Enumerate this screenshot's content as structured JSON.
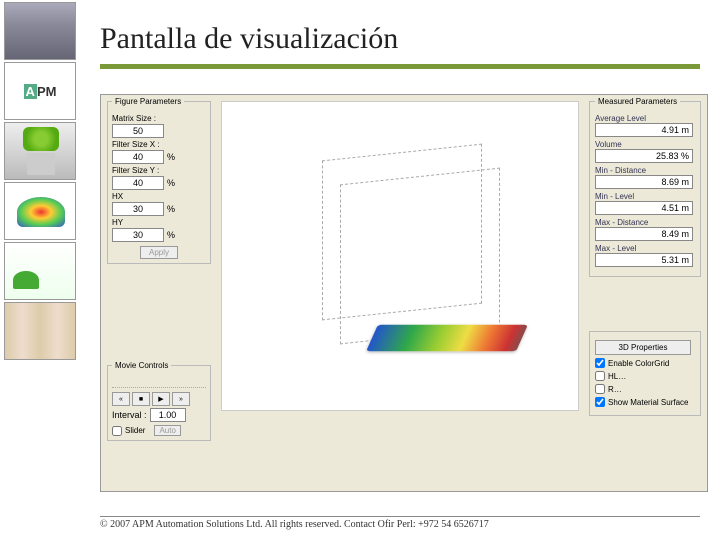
{
  "title": "Pantalla de visualización",
  "leftPanel": {
    "figureGroup": "Figure Parameters",
    "matrixSize": {
      "label": "Matrix Size :",
      "value": "50"
    },
    "filterX": {
      "label": "Filter Size X :",
      "value": "40",
      "unit": "%"
    },
    "filterY": {
      "label": "Filter Size Y :",
      "value": "40",
      "unit": "%"
    },
    "hx": {
      "label": "HX",
      "value": "30",
      "unit": "%"
    },
    "hy": {
      "label": "HY",
      "value": "30",
      "unit": "%"
    },
    "apply": "Apply",
    "movieGroup": "Movie Controls",
    "btns": {
      "rw": "«",
      "stop": "■",
      "play": "▶",
      "ff": "»"
    },
    "intervalLabel": "Interval :",
    "intervalVal": "1.00",
    "sliderLabel": "Slider",
    "autoBtn": "Auto"
  },
  "rightPanel": {
    "measGroup": "Measured Parameters",
    "avgLevel": {
      "label": "Average Level",
      "value": "4.91 m"
    },
    "volume": {
      "label": "Volume",
      "value": "25.83 %"
    },
    "minDist": {
      "label": "Min - Distance",
      "value": "8.69 m"
    },
    "minLevel": {
      "label": "Min - Level",
      "value": "4.51 m"
    },
    "maxDist": {
      "label": "Max - Distance",
      "value": "8.49 m"
    },
    "maxLevel": {
      "label": "Max - Level",
      "value": "5.31 m"
    },
    "propBtn": "3D Properties",
    "chk1": "Enable ColorGrid",
    "chk2": "HL…",
    "chk3": "R…",
    "chk4": "Show Material Surface"
  },
  "footer": "© 2007 APM Automation Solutions Ltd. All rights reserved. Contact Ofir Perl: +972 54 6526717"
}
